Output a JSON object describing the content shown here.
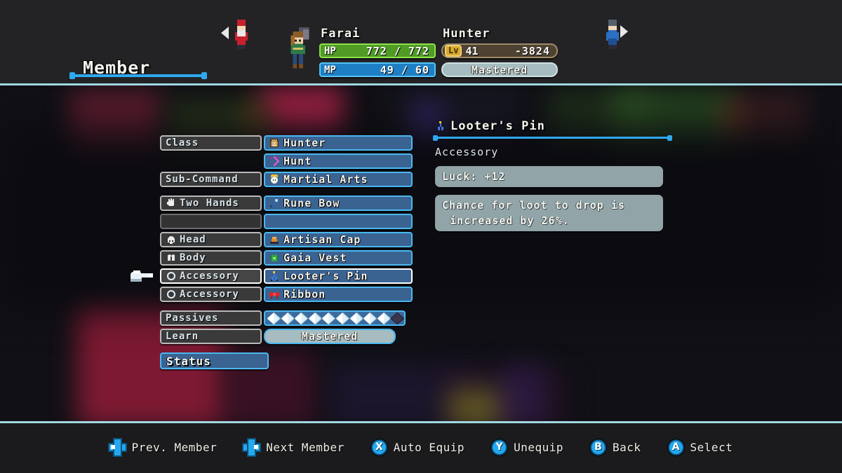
{
  "menu": {
    "title": "Member"
  },
  "character": {
    "name": "Farai",
    "class_name": "Hunter",
    "hp_tag": "HP",
    "hp_value": "772 / 772",
    "mp_tag": "MP",
    "mp_value": "49 / 60",
    "lv_tag": "Lv",
    "lv_value": "41",
    "exp_value": "-3824",
    "class_progress": "Mastered"
  },
  "equipment": {
    "rows": [
      {
        "label": "Class",
        "icon": "hunter-portrait-icon",
        "value": "Hunter",
        "selected": false,
        "empty": false
      },
      {
        "label": "",
        "icon": "hunt-skill-icon",
        "value": "Hunt",
        "selected": false,
        "empty": false,
        "no_label": true
      },
      {
        "label": "Sub-Command",
        "icon": "martial-arts-icon",
        "value": "Martial Arts",
        "selected": false,
        "empty": false
      },
      {
        "label": "Two Hands",
        "icon": "rune-bow-icon",
        "value": "Rune Bow",
        "selected": false,
        "empty": false,
        "label_icon": "hand-icon"
      },
      {
        "label": "",
        "icon": "",
        "value": "",
        "selected": false,
        "empty": true
      },
      {
        "label": "Head",
        "icon": "artisan-cap-icon",
        "value": "Artisan Cap",
        "selected": false,
        "empty": false,
        "label_icon": "helmet-icon"
      },
      {
        "label": "Body",
        "icon": "gaia-vest-icon",
        "value": "Gaia Vest",
        "selected": false,
        "empty": false,
        "label_icon": "armor-icon"
      },
      {
        "label": "Accessory",
        "icon": "looters-pin-icon",
        "value": "Looter's Pin",
        "selected": true,
        "empty": false,
        "label_icon": "ring-icon"
      },
      {
        "label": "Accessory",
        "icon": "ribbon-icon",
        "value": "Ribbon",
        "selected": false,
        "empty": false,
        "label_icon": "ring-icon"
      }
    ],
    "passives_label": "Passives",
    "passives_filled": 9,
    "passives_empty": 1,
    "learn_label": "Learn",
    "learn_value": "Mastered",
    "status_label": "Status"
  },
  "info": {
    "item_name": "Looter's Pin",
    "item_icon": "looters-pin-icon",
    "item_type": "Accessory",
    "stat_line": "Luck:  +12",
    "description_line_1": "Chance for loot to drop is",
    "description_line_2": "increased by 26%."
  },
  "actions": [
    {
      "icon": "dpad-left-icon",
      "label": "Prev. Member",
      "kind": "dpad",
      "dir": "left"
    },
    {
      "icon": "dpad-right-icon",
      "label": "Next Member",
      "kind": "dpad",
      "dir": "right"
    },
    {
      "icon": "button-x-icon",
      "label": "Auto Equip",
      "kind": "btn",
      "glyph": "X"
    },
    {
      "icon": "button-y-icon",
      "label": "Unequip",
      "kind": "btn",
      "glyph": "Y"
    },
    {
      "icon": "button-b-icon",
      "label": "Back",
      "kind": "btn",
      "glyph": "B"
    },
    {
      "icon": "button-a-icon",
      "label": "Select",
      "kind": "btn",
      "glyph": "A"
    }
  ],
  "colors": {
    "accent_blue": "#2fa8ef",
    "panel_blue": "#3a6392",
    "border_cyan": "#4ab8f0",
    "hp_green": "#4f9b24",
    "mp_blue": "#1f7fc4",
    "header_bg": "#232326",
    "selected_border": "#ffffff"
  }
}
